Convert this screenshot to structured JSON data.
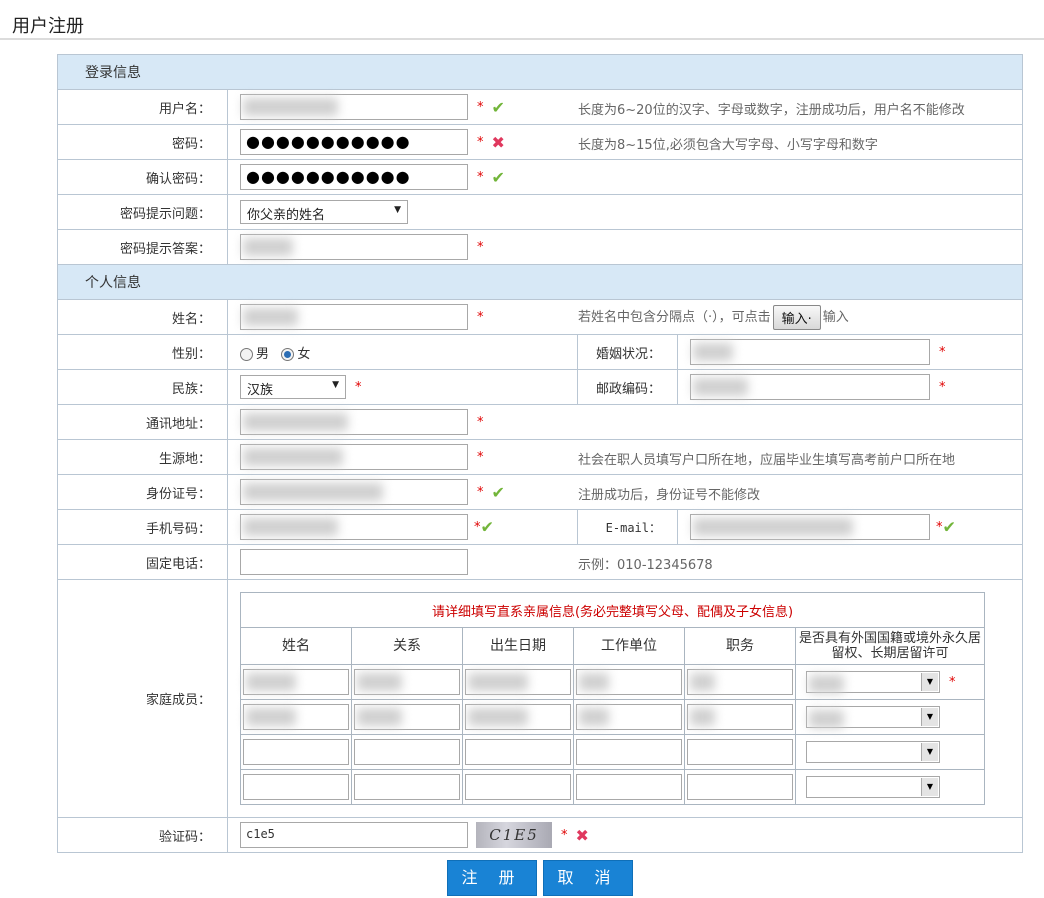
{
  "page": {
    "title": "用户注册"
  },
  "login_section": {
    "label": "登录信息",
    "username": {
      "label": "用户名：",
      "hint": "长度为6~20位的汉字、字母或数字，注册成功后，用户名不能修改"
    },
    "password": {
      "label": "密码：",
      "value": "●●●●●●●●●●●",
      "hint": "长度为8~15位,必须包含大写字母、小写字母和数字"
    },
    "confirm_password": {
      "label": "确认密码：",
      "value": "●●●●●●●●●●●"
    },
    "question": {
      "label": "密码提示问题：",
      "selected": "你父亲的姓名"
    },
    "answer": {
      "label": "密码提示答案："
    }
  },
  "personal_section": {
    "label": "个人信息",
    "name": {
      "label": "姓名：",
      "hint_pre": "若姓名中包含分隔点（·），可点击",
      "button": "输入·",
      "hint_post": "输入"
    },
    "gender": {
      "label": "性别：",
      "male": "男",
      "female": "女"
    },
    "marital": {
      "label": "婚姻状况："
    },
    "ethnicity": {
      "label": "民族：",
      "selected": "汉族"
    },
    "postcode": {
      "label": "邮政编码："
    },
    "address": {
      "label": "通讯地址："
    },
    "origin": {
      "label": "生源地：",
      "hint": "社会在职人员填写户口所在地，应届毕业生填写高考前户口所在地"
    },
    "id_number": {
      "label": "身份证号：",
      "hint": "注册成功后，身份证号不能修改"
    },
    "mobile": {
      "label": "手机号码："
    },
    "email": {
      "label": "E-mail："
    },
    "landline": {
      "label": "固定电话：",
      "hint": "示例：010-12345678"
    },
    "family": {
      "label": "家庭成员：",
      "notice": "请详细填写直系亲属信息(务必完整填写父母、配偶及子女信息)",
      "columns": [
        "姓名",
        "关系",
        "出生日期",
        "工作单位",
        "职务",
        "是否具有外国国籍或境外永久居留权、长期居留许可"
      ]
    },
    "captcha": {
      "label": "验证码：",
      "value": "c1e5",
      "image_text": "C1E5"
    }
  },
  "actions": {
    "submit": "注 册",
    "cancel": "取 消"
  },
  "symbols": {
    "required": "*",
    "ok": "✔",
    "error": "✖"
  },
  "colors": {
    "section_bg": "#d7e8f6",
    "button": "#1983d5",
    "required": "#e00000",
    "ok": "#72b53a",
    "error": "#e0385e"
  }
}
